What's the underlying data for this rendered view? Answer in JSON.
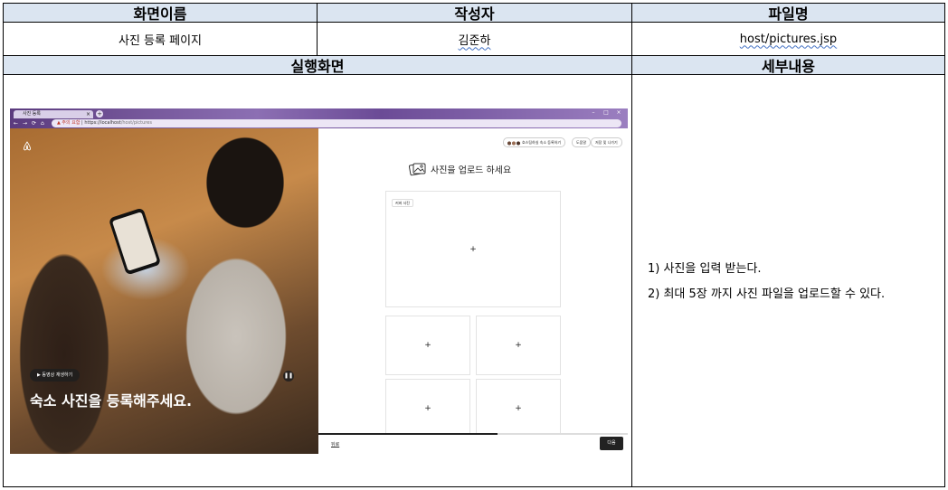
{
  "table": {
    "headers": {
      "screen_name": "화면이름",
      "author": "작성자",
      "file_name": "파일명",
      "execution_screen": "실행화면",
      "details": "세부내용"
    },
    "screen_name_value": "사진 등록 페이지",
    "author_value": "김준하",
    "file_name_value": "host/pictures.jsp",
    "details": [
      "1) 사진을 입력 받는다.",
      "2) 최대 5장 까지 사진 파일을 업로드할 수 있다."
    ]
  },
  "browser": {
    "tab_title": "사진 등록",
    "tab_close": "×",
    "new_tab": "+",
    "warning_label": "▲ 주의 요함",
    "url_host": "https://localhost",
    "url_path": "/host/pictures",
    "nav_icons": [
      "←",
      "→",
      "⟳",
      "⌂"
    ],
    "window_controls": [
      "–",
      "□",
      "×"
    ]
  },
  "left_panel": {
    "logo_icon": "airbnb-logo-icon",
    "video_button": "▶ 동영상 재생하기",
    "pause_icon": "❚❚",
    "headline": "숙소 사진을 등록해주세요."
  },
  "right_panel": {
    "top_buttons": [
      "호스팅하실 숙소 등록하기",
      "도움말",
      "저장 및 나가기"
    ],
    "title": "사진을 업로드 하세요",
    "cover_label": "커버 사진",
    "plus": "+",
    "back_link": "뒤로",
    "next_button": "다음",
    "progress": 0.58
  }
}
